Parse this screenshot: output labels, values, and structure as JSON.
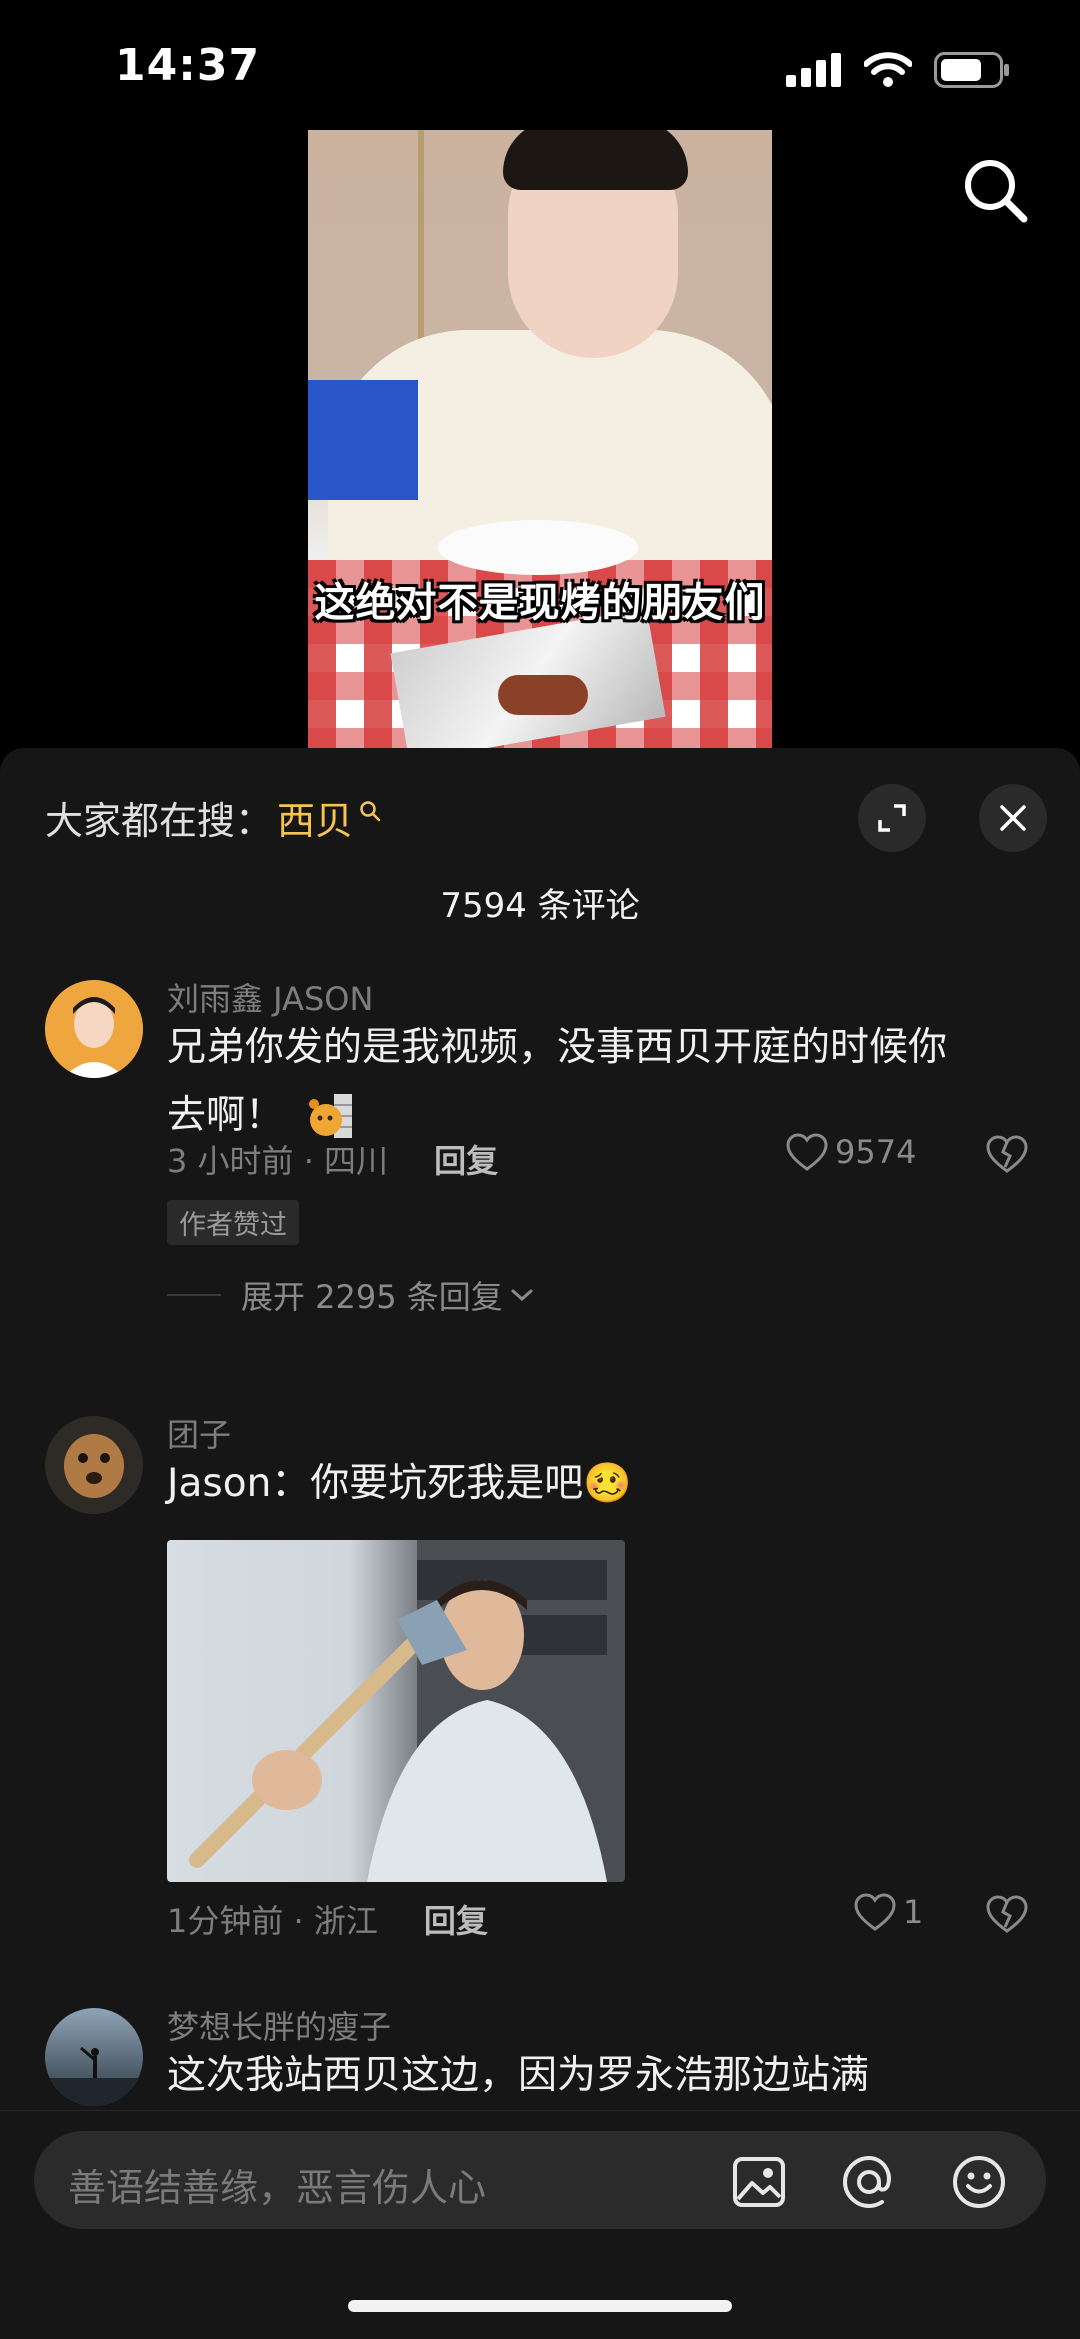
{
  "status_bar": {
    "time": "14:37"
  },
  "video": {
    "caption": "这绝对不是现烤的朋友们"
  },
  "sheet": {
    "trending_prefix": "大家都在搜：",
    "trending_keyword": "西贝",
    "comment_count": "7594 条评论"
  },
  "comments": [
    {
      "username": "刘雨鑫 JASON",
      "text_line1": "兄弟你发的是我视频，没事西贝开庭的时候你",
      "text_line2": "去啊！",
      "time_location": "3 小时前 · 四川",
      "reply_label": "回复",
      "likes": "9574",
      "badge": "作者赞过",
      "expand_replies": "展开 2295 条回复"
    },
    {
      "username": "团子",
      "text": "Jason：你要坑死我是吧",
      "emoji": "🥴",
      "time_location": "1分钟前 · 浙江",
      "reply_label": "回复",
      "likes": "1"
    },
    {
      "username": "梦想长胖的瘦子",
      "text": "这次我站西贝这边，因为罗永浩那边站满"
    }
  ],
  "input_bar": {
    "placeholder": "善语结善缘，恶言伤人心"
  },
  "icons": [
    "search-icon",
    "expand-icon",
    "close-icon",
    "heart-icon",
    "broken-heart-icon",
    "image-icon",
    "at-icon",
    "emoji-icon",
    "chevron-down-icon"
  ],
  "colors": {
    "background": "#161616",
    "accent_keyword": "#f5c451"
  }
}
